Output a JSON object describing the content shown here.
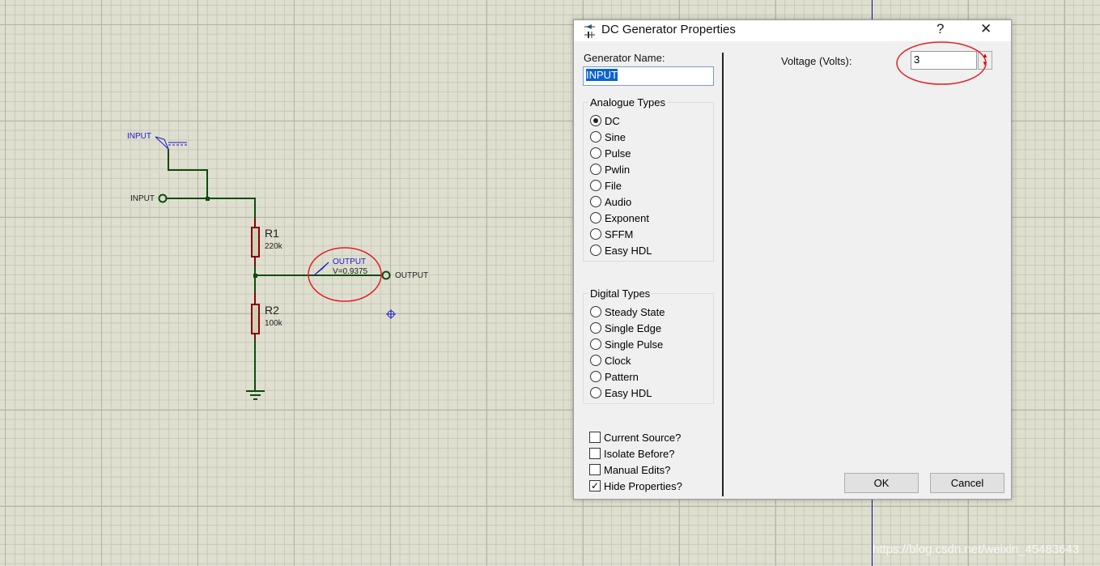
{
  "schematic": {
    "generator_label": "INPUT",
    "input_terminal": "INPUT",
    "r1": {
      "name": "R1",
      "value": "220k"
    },
    "r2": {
      "name": "R2",
      "value": "100k"
    },
    "probe": {
      "name": "OUTPUT",
      "reading": "V=0.9375"
    },
    "output_terminal": "OUTPUT"
  },
  "dialog": {
    "title": "DC Generator Properties",
    "help": "?",
    "close": "✕",
    "generator_name_label": "Generator Name:",
    "generator_name_value": "INPUT",
    "analogue_title": "Analogue Types",
    "analogue": [
      "DC",
      "Sine",
      "Pulse",
      "Pwlin",
      "File",
      "Audio",
      "Exponent",
      "SFFM",
      "Easy HDL"
    ],
    "analogue_selected": "DC",
    "digital_title": "Digital Types",
    "digital": [
      "Steady State",
      "Single Edge",
      "Single Pulse",
      "Clock",
      "Pattern",
      "Easy HDL"
    ],
    "options": [
      {
        "label": "Current Source?",
        "checked": false
      },
      {
        "label": "Isolate Before?",
        "checked": false
      },
      {
        "label": "Manual Edits?",
        "checked": false
      },
      {
        "label": "Hide Properties?",
        "checked": true
      }
    ],
    "voltage_label": "Voltage (Volts):",
    "voltage_value": "3",
    "ok": "OK",
    "cancel": "Cancel"
  },
  "watermark": "https://blog.csdn.net/weixin_45483643",
  "colors": {
    "wire": "#0b4d0b",
    "resistor": "#8b0000",
    "probe": "#1a1ad0",
    "highlight": "#e0202a"
  }
}
